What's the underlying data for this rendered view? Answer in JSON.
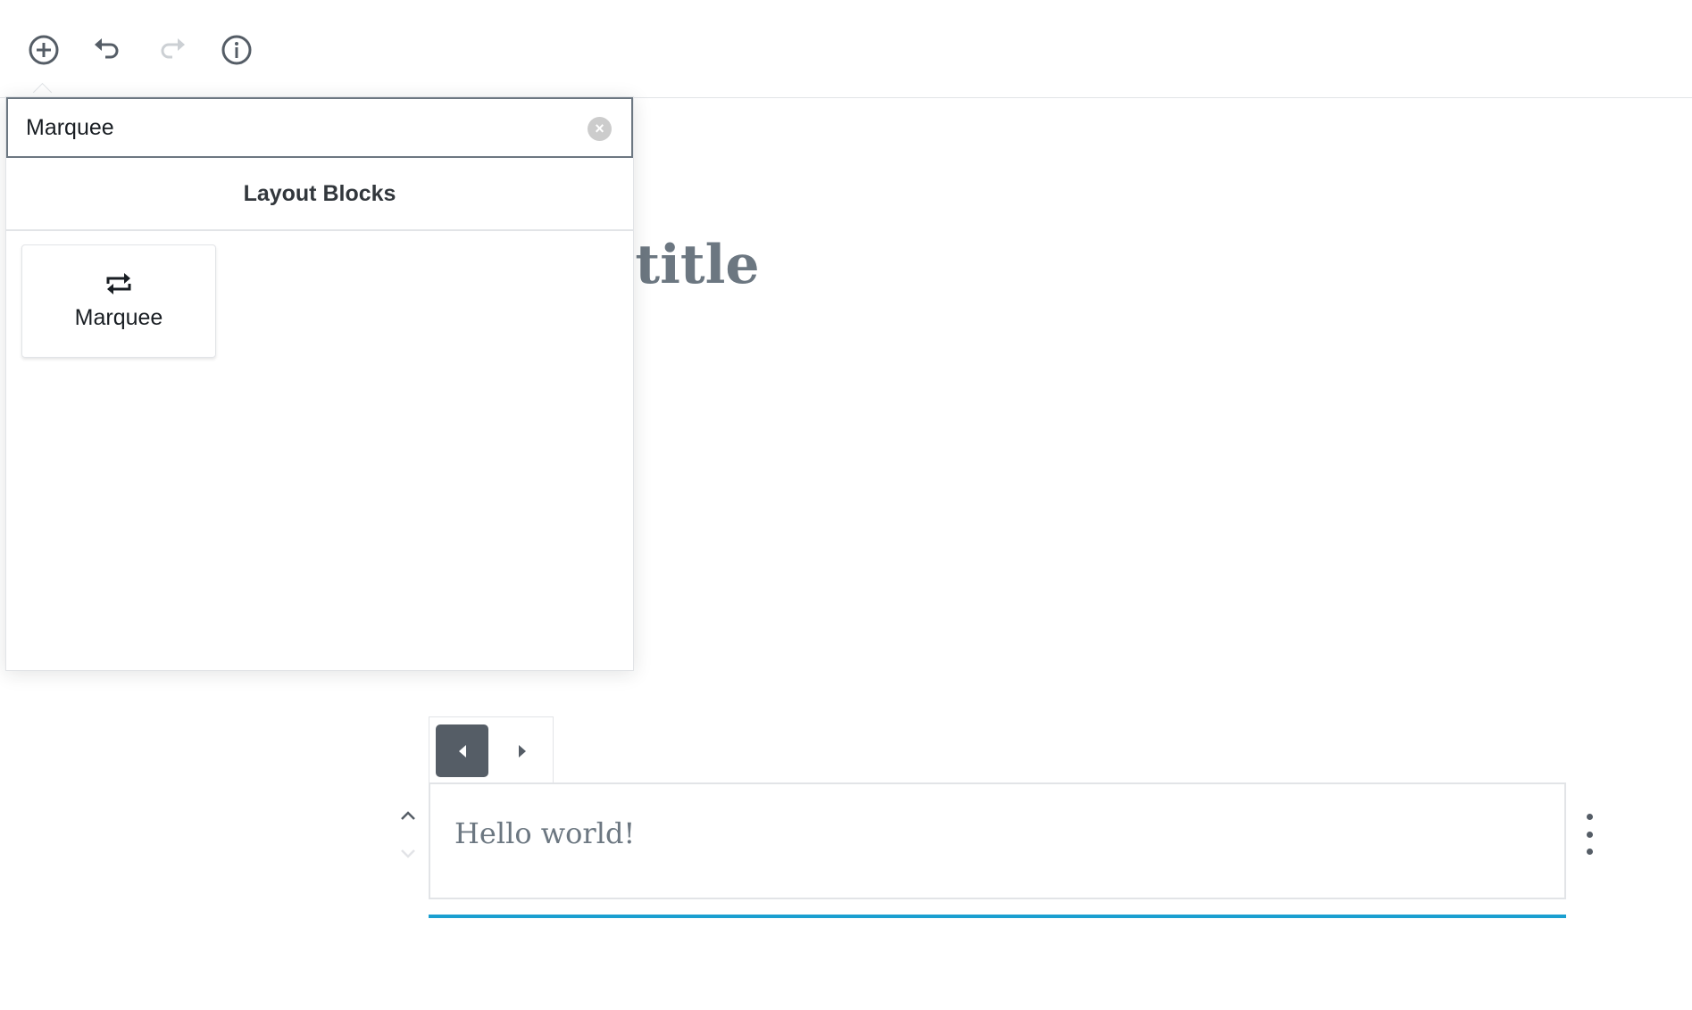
{
  "toolbar": {
    "icons": [
      "plus-circle-icon",
      "undo-icon",
      "redo-icon",
      "info-icon"
    ],
    "redo_disabled": true
  },
  "editor": {
    "title_placeholder": "Add title"
  },
  "inserter": {
    "search_value": "Marquee",
    "section_title": "Layout Blocks",
    "results": [
      {
        "label": "Marquee",
        "icon": "repeat-arrows-icon"
      }
    ]
  },
  "block": {
    "toolbar": {
      "buttons": [
        "align-left-arrow-icon",
        "align-right-arrow-icon"
      ],
      "active": "align-left-arrow-icon"
    },
    "content": "Hello world!"
  },
  "colors": {
    "accent": "#1a9fd0",
    "icon_dark": "#555d66",
    "disabled": "#ccd0d4"
  }
}
